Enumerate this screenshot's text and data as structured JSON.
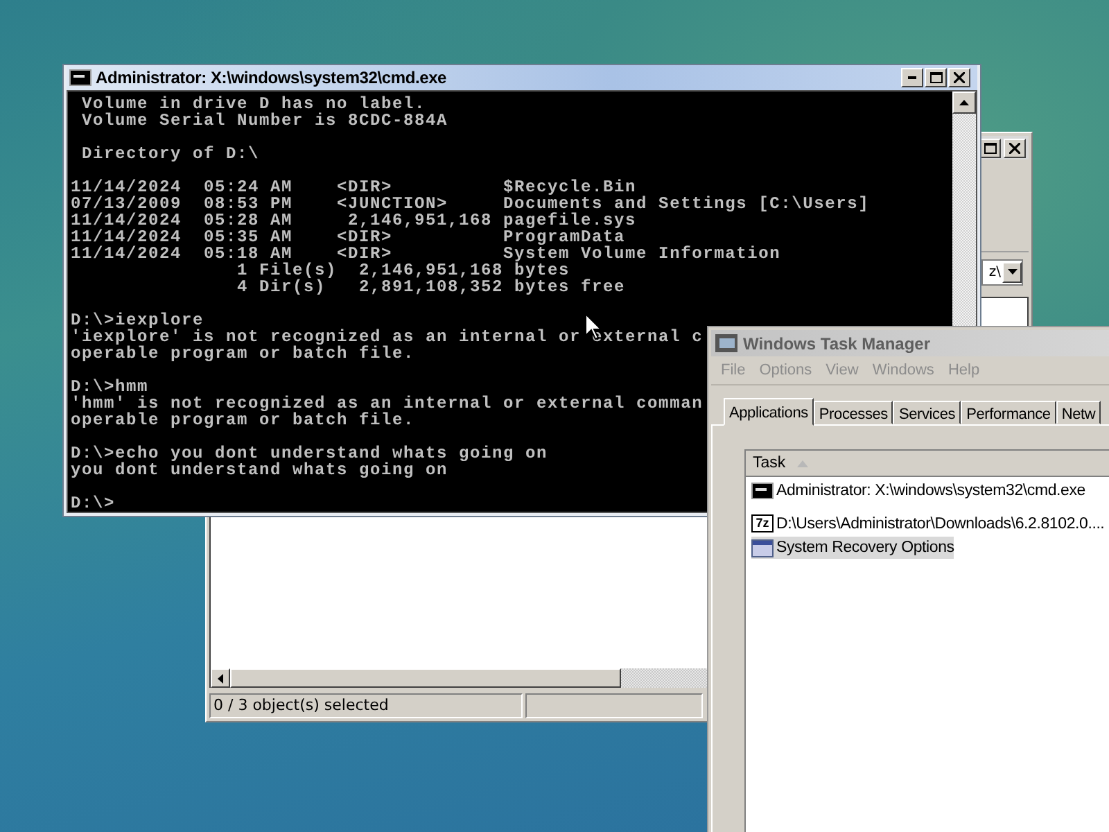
{
  "explorer_window": {
    "address": "z\\",
    "status": "0 / 3 object(s) selected"
  },
  "cmd_window": {
    "title": "Administrator: X:\\windows\\system32\\cmd.exe",
    "blocks": [
      [
        " Volume in drive D has no label.",
        " Volume Serial Number is 8CDC-884A"
      ],
      [
        " Directory of D:\\"
      ],
      [
        "11/14/2024  05:24 AM    <DIR>          $Recycle.Bin",
        "07/13/2009  08:53 PM    <JUNCTION>     Documents and Settings [C:\\Users]",
        "11/14/2024  05:28 AM     2,146,951,168 pagefile.sys",
        "11/14/2024  05:35 AM    <DIR>          ProgramData",
        "11/14/2024  05:18 AM    <DIR>          System Volume Information",
        "               1 File(s)  2,146,951,168 bytes",
        "               4 Dir(s)   2,891,108,352 bytes free"
      ],
      [
        "D:\\>iexplore",
        "'iexplore' is not recognized as an internal or external c",
        "operable program or batch file."
      ],
      [
        "D:\\>hmm",
        "'hmm' is not recognized as an internal or external comman",
        "operable program or batch file."
      ],
      [
        "D:\\>echo you dont understand whats going on",
        "you dont understand whats going on"
      ],
      [
        "D:\\>"
      ]
    ]
  },
  "task_manager": {
    "title": "Windows Task Manager",
    "menu": [
      "File",
      "Options",
      "View",
      "Windows",
      "Help"
    ],
    "tabs": [
      {
        "label": "Applications",
        "selected": true
      },
      {
        "label": "Processes",
        "selected": false
      },
      {
        "label": "Services",
        "selected": false
      },
      {
        "label": "Performance",
        "selected": false
      },
      {
        "label": "Netw",
        "selected": false
      }
    ],
    "column": "Task",
    "tasks": [
      {
        "kind": "console",
        "name": "Administrator: X:\\windows\\system32\\cmd.exe",
        "selected": false
      },
      {
        "kind": "archive",
        "badge": "7z",
        "name": "D:\\Users\\Administrator\\Downloads\\6.2.8102.0....",
        "selected": false
      },
      {
        "kind": "window",
        "name": "System Recovery Options",
        "selected": true
      }
    ]
  }
}
